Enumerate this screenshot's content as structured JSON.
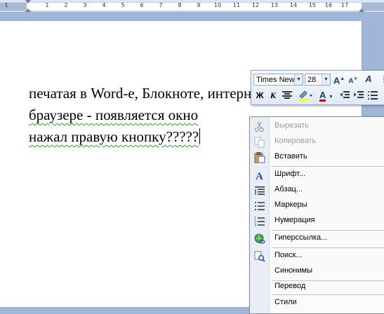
{
  "ruler": {
    "numbers": [
      "1",
      "1",
      "2",
      "3",
      "4",
      "5",
      "6",
      "7",
      "8",
      "9",
      "10",
      "11",
      "12",
      "13",
      "14",
      "15",
      "16",
      "17"
    ]
  },
  "document": {
    "lines": [
      "печатая в Word-е, Блокноте, интернет",
      "браузере -   появляется окно",
      "нажал правую кнопку?????"
    ]
  },
  "mini_toolbar": {
    "font_name": "Times New",
    "font_size": "28",
    "grow_font": "A",
    "shrink_font": "A",
    "styles": "A",
    "bold": "Ж",
    "italic": "К",
    "font_color": "A"
  },
  "context_menu": {
    "items": [
      {
        "label": "Вырезать",
        "icon": "scissors-icon",
        "disabled": true
      },
      {
        "label": "Копировать",
        "icon": "copy-icon",
        "disabled": true
      },
      {
        "label": "Вставить",
        "icon": "paste-icon",
        "disabled": false
      },
      {
        "label": "Шрифт...",
        "icon": "font-icon",
        "disabled": false
      },
      {
        "label": "Абзац...",
        "icon": "paragraph-icon",
        "disabled": false
      },
      {
        "label": "Маркеры",
        "icon": "bullets-icon",
        "disabled": false
      },
      {
        "label": "Нумерация",
        "icon": "numbering-icon",
        "disabled": false
      },
      {
        "label": "Гиперссылка...",
        "icon": "hyperlink-icon",
        "disabled": false
      },
      {
        "label": "Поиск...",
        "icon": "search-icon",
        "disabled": false
      },
      {
        "label": "Синонимы",
        "icon": "",
        "disabled": false
      },
      {
        "label": "Перевод",
        "icon": "",
        "disabled": false
      },
      {
        "label": "Стили",
        "icon": "",
        "disabled": false
      }
    ]
  },
  "colors": {
    "workspace": "#9fb6d6",
    "menu_gutter": "#e9eef6",
    "font_color_bar": "#c00000",
    "highlight_bar": "#ffff00"
  }
}
